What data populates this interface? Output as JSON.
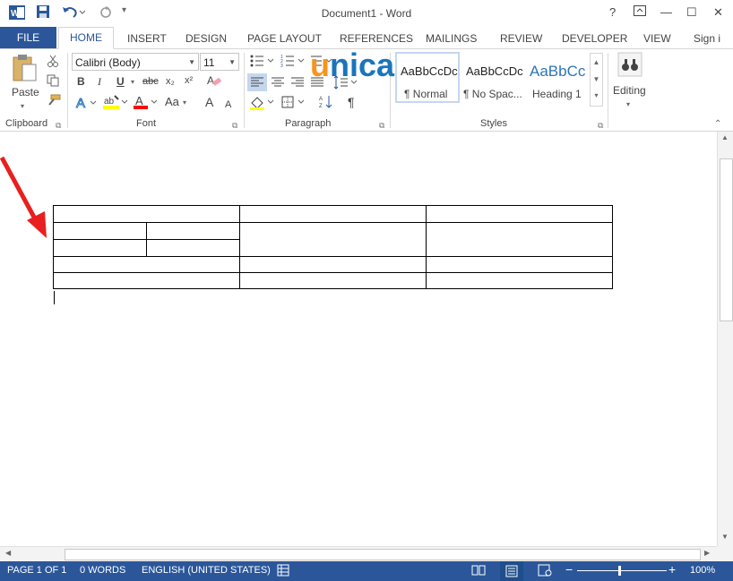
{
  "titlebar": {
    "title": "Document1 - Word",
    "help": "?",
    "ribbon_options": "⊡",
    "minimize": "—",
    "restore": "☐",
    "close": "✕"
  },
  "tabs": {
    "file": "FILE",
    "home": "HOME",
    "insert": "INSERT",
    "design": "DESIGN",
    "page_layout": "PAGE LAYOUT",
    "references": "REFERENCES",
    "mailings": "MAILINGS",
    "review": "REVIEW",
    "developer": "DEVELOPER",
    "view": "VIEW",
    "sign_in": "Sign i"
  },
  "clipboard": {
    "paste": "Paste",
    "group": "Clipboard"
  },
  "font": {
    "family": "Calibri (Body)",
    "size": "11",
    "bold": "B",
    "italic": "I",
    "underline": "U",
    "strike": "abc",
    "subscript": "x₂",
    "superscript": "x²",
    "case": "Aa",
    "grow": "A",
    "shrink": "A",
    "color_letter": "A",
    "group": "Font"
  },
  "paragraph": {
    "pilcrow": "¶",
    "group": "Paragraph"
  },
  "styles": {
    "items": [
      {
        "sample": "AaBbCcDc",
        "name": "¶ Normal"
      },
      {
        "sample": "AaBbCcDc",
        "name": "¶ No Spac..."
      },
      {
        "sample": "AaBbCc",
        "name": "Heading 1"
      }
    ],
    "group": "Styles"
  },
  "editing": {
    "label": "Editing"
  },
  "watermark": {
    "text": "unica"
  },
  "status": {
    "page": "PAGE 1 OF 1",
    "words": "0 WORDS",
    "language": "ENGLISH (UNITED STATES)",
    "zoom": "100%",
    "minus": "−",
    "plus": "+"
  },
  "colors": {
    "accent": "#2b579a",
    "highlight": "#ffff00",
    "font_color": "#ff0000",
    "arrow": "#e8201f",
    "logo_orange": "#f7941d",
    "logo_blue": "#1a75bc"
  }
}
